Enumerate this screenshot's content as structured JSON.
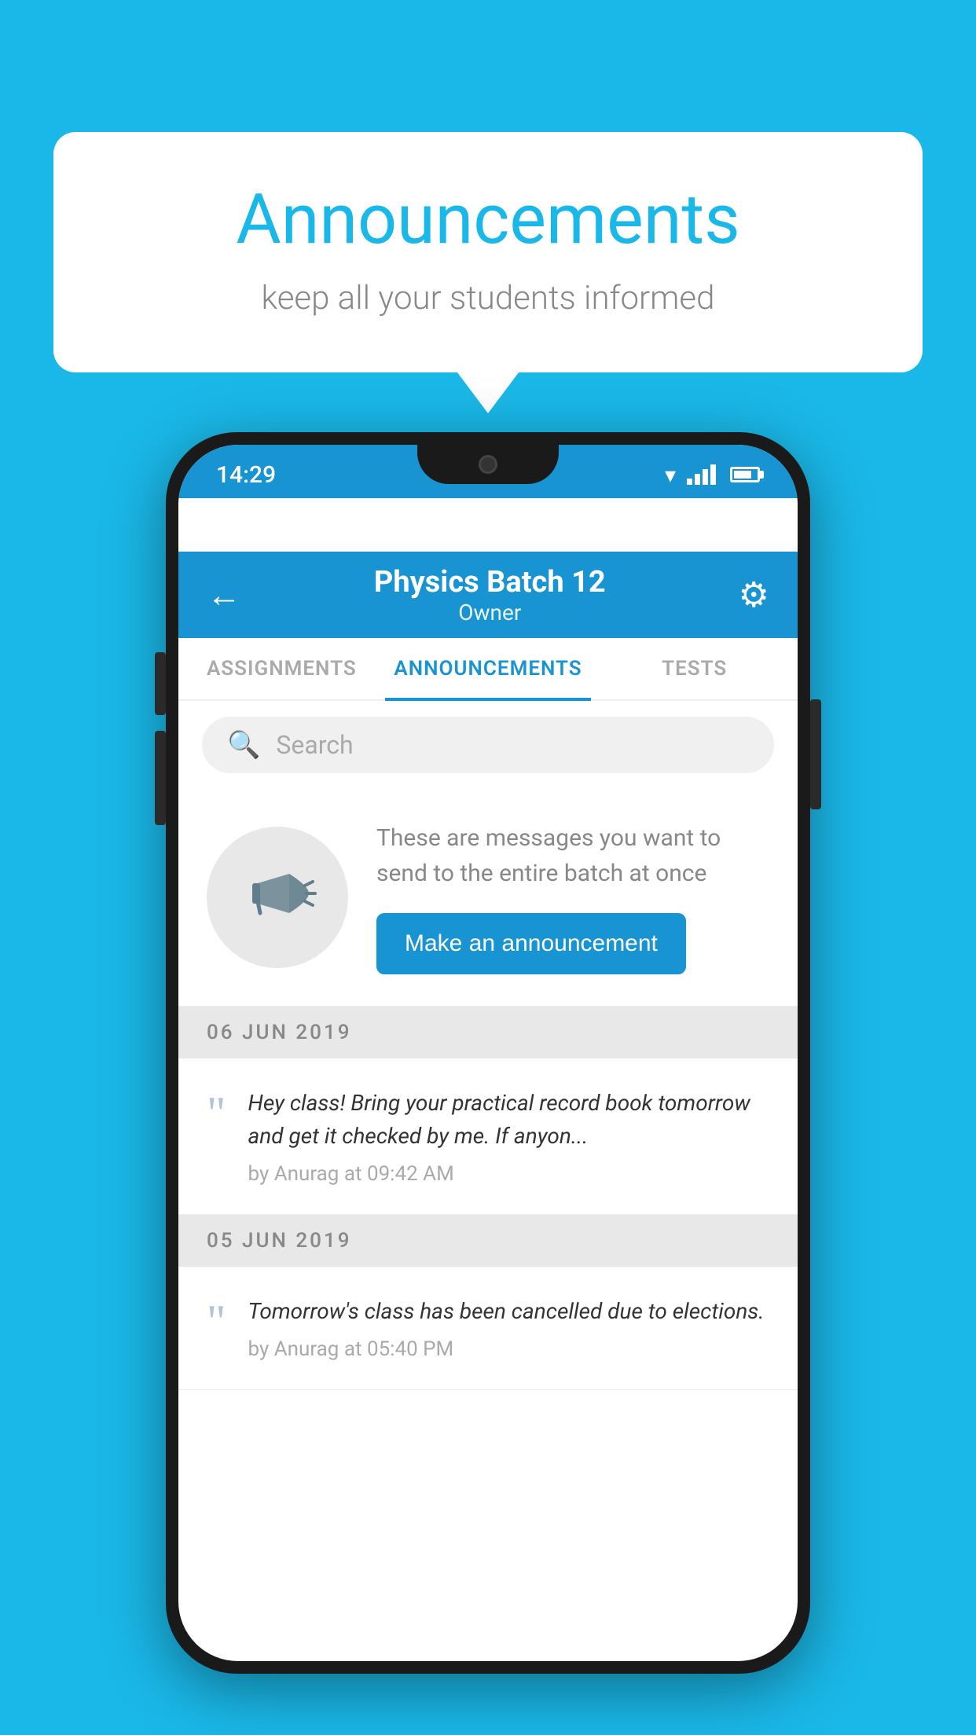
{
  "bubble": {
    "title": "Announcements",
    "subtitle": "keep all your students informed"
  },
  "statusBar": {
    "time": "14:29",
    "icons": [
      "wifi",
      "signal",
      "battery"
    ]
  },
  "header": {
    "title": "Physics Batch 12",
    "subtitle": "Owner",
    "backLabel": "←",
    "gearLabel": "⚙"
  },
  "tabs": [
    {
      "label": "ASSIGNMENTS",
      "active": false
    },
    {
      "label": "ANNOUNCEMENTS",
      "active": true
    },
    {
      "label": "TESTS",
      "active": false
    },
    {
      "label": "...",
      "active": false
    }
  ],
  "search": {
    "placeholder": "Search"
  },
  "announcementPrompt": {
    "description": "These are messages you want to send to the entire batch at once",
    "buttonLabel": "Make an announcement"
  },
  "announcements": [
    {
      "date": "06  JUN  2019",
      "text": "Hey class! Bring your practical record book tomorrow and get it checked by me. If anyon...",
      "meta": "by Anurag at 09:42 AM"
    },
    {
      "date": "05  JUN  2019",
      "text": "Tomorrow's class has been cancelled due to elections.",
      "meta": "by Anurag at 05:40 PM"
    }
  ],
  "colors": {
    "primary": "#1994d2",
    "background": "#1ab8e8",
    "white": "#ffffff"
  }
}
